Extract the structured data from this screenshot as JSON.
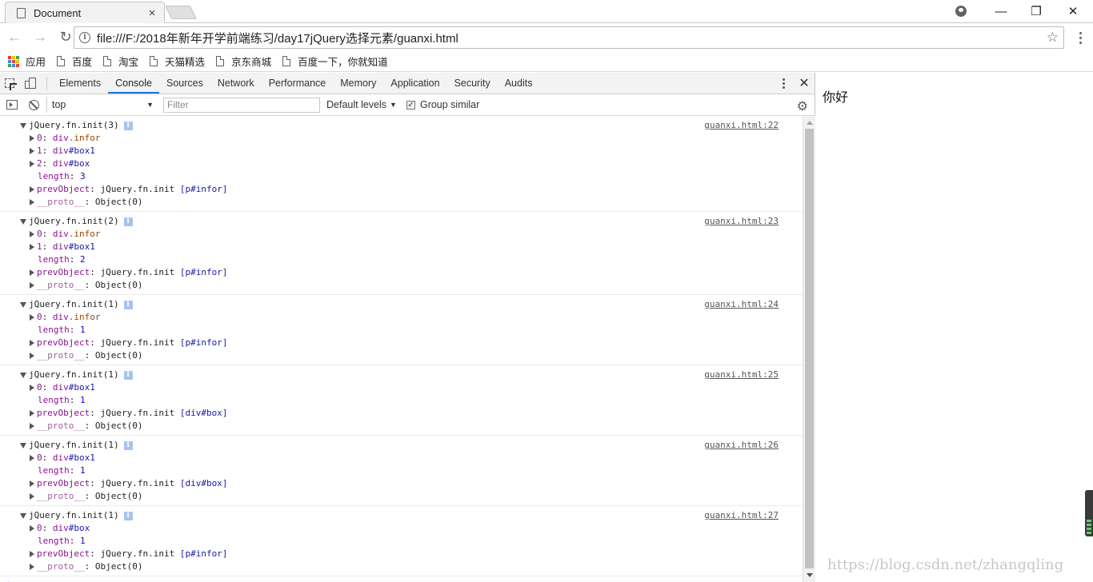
{
  "window": {
    "tab_title": "Document",
    "tab_close": "×"
  },
  "toolbar": {
    "url": "file:///F:/2018年新年开学前端练习/day17jQuery选择元素/guanxi.html"
  },
  "bookmarks": [
    {
      "label": "应用",
      "icon": "apps-icon"
    },
    {
      "label": "百度",
      "icon": "page-icon"
    },
    {
      "label": "淘宝",
      "icon": "page-icon"
    },
    {
      "label": "天猫精选",
      "icon": "page-icon"
    },
    {
      "label": "京东商城",
      "icon": "page-icon"
    },
    {
      "label": "百度一下，你就知道",
      "icon": "page-icon"
    }
  ],
  "devtools": {
    "tabs": [
      "Elements",
      "Console",
      "Sources",
      "Network",
      "Performance",
      "Memory",
      "Application",
      "Security",
      "Audits"
    ],
    "active_tab": "Console",
    "context": "top",
    "filter_placeholder": "Filter",
    "levels_label": "Default levels",
    "group_similar_label": "Group similar",
    "group_similar_checked": true
  },
  "console": {
    "entries": [
      {
        "header": "jQuery.fn.init(3)",
        "source": "guanxi.html:22",
        "children": [
          {
            "key": "0",
            "node": "div",
            "sel": ".infor",
            "selType": "class"
          },
          {
            "key": "1",
            "node": "div",
            "sel": "#box1",
            "selType": "id"
          },
          {
            "key": "2",
            "node": "div",
            "sel": "#box",
            "selType": "id"
          }
        ],
        "length": "3",
        "prev": "[p#infor]"
      },
      {
        "header": "jQuery.fn.init(2)",
        "source": "guanxi.html:23",
        "children": [
          {
            "key": "0",
            "node": "div",
            "sel": ".infor",
            "selType": "class"
          },
          {
            "key": "1",
            "node": "div",
            "sel": "#box1",
            "selType": "id"
          }
        ],
        "length": "2",
        "prev": "[p#infor]"
      },
      {
        "header": "jQuery.fn.init(1)",
        "source": "guanxi.html:24",
        "children": [
          {
            "key": "0",
            "node": "div",
            "sel": ".infor",
            "selType": "class"
          }
        ],
        "length": "1",
        "prev": "[p#infor]"
      },
      {
        "header": "jQuery.fn.init(1)",
        "source": "guanxi.html:25",
        "children": [
          {
            "key": "0",
            "node": "div",
            "sel": "#box1",
            "selType": "id"
          }
        ],
        "length": "1",
        "prev": "[div#box]"
      },
      {
        "header": "jQuery.fn.init(1)",
        "source": "guanxi.html:26",
        "children": [
          {
            "key": "0",
            "node": "div",
            "sel": "#box1",
            "selType": "id"
          }
        ],
        "length": "1",
        "prev": "[div#box]"
      },
      {
        "header": "jQuery.fn.init(1)",
        "source": "guanxi.html:27",
        "children": [
          {
            "key": "0",
            "node": "div",
            "sel": "#box",
            "selType": "id"
          }
        ],
        "length": "1",
        "prev": "[p#infor]"
      }
    ],
    "labels": {
      "length": "length",
      "prevObject": "prevObject",
      "prevValue": "jQuery.fn.init",
      "proto": "__proto__",
      "protoValue": "Object(0)"
    }
  },
  "page": {
    "text": "你好"
  },
  "watermark": "https://blog.csdn.net/zhangqling",
  "colors": {
    "accent": "#1a73e8",
    "apps_icon": [
      "#e53935",
      "#fbbc05",
      "#34a853",
      "#4285f4",
      "#ea4335",
      "#fbbc05",
      "#34a853",
      "#4285f4",
      "#ea4335"
    ]
  }
}
